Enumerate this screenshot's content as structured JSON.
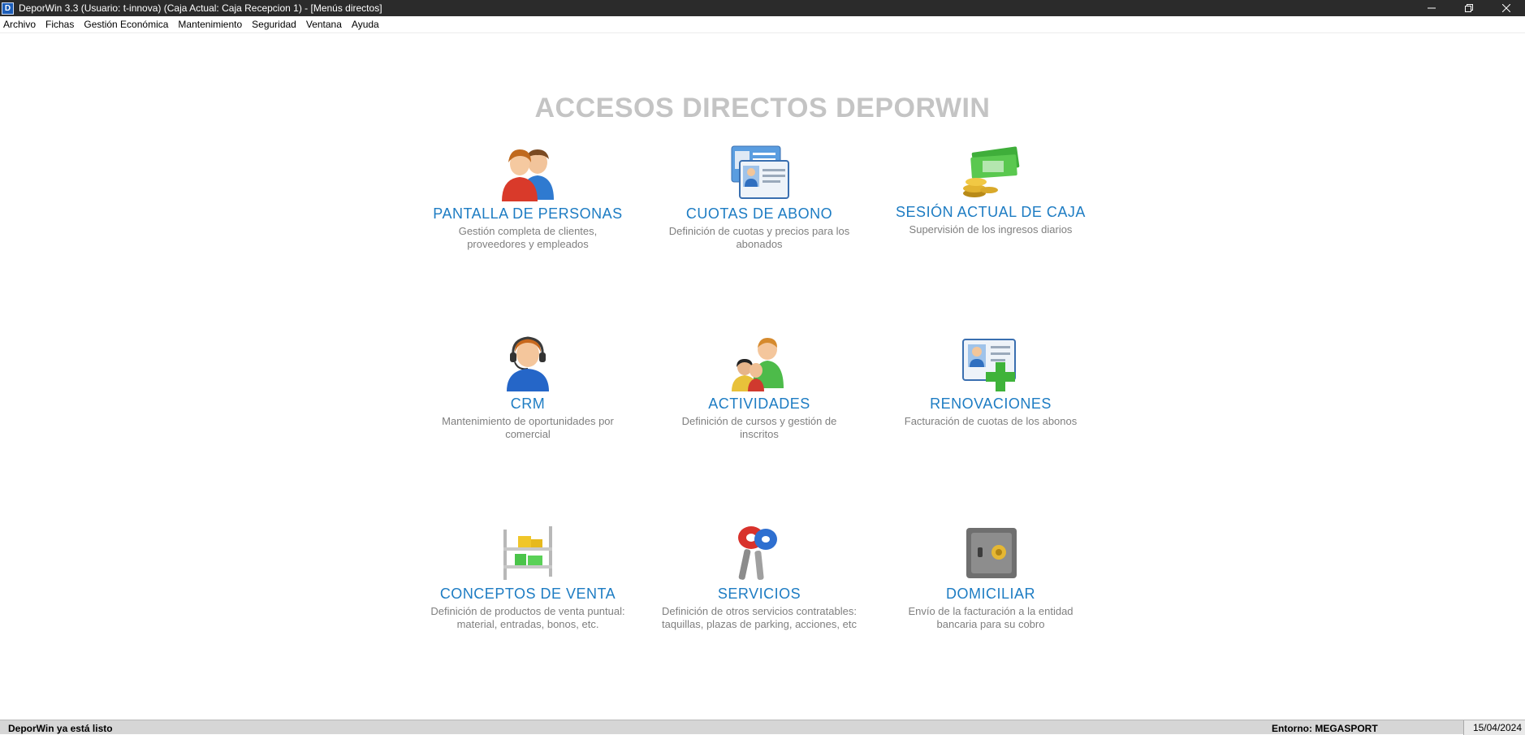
{
  "titlebar": {
    "title": "DeporWin 3.3  (Usuario: t-innova)  (Caja Actual: Caja Recepcion 1) - [Menús directos]",
    "logo_letter": "D"
  },
  "menu": [
    "Archivo",
    "Fichas",
    "Gestión Económica",
    "Mantenimiento",
    "Seguridad",
    "Ventana",
    "Ayuda"
  ],
  "page_title": "ACCESOS DIRECTOS DEPORWIN",
  "tiles": [
    {
      "title": "PANTALLA DE PERSONAS",
      "desc": "Gestión completa de clientes, proveedores y empleados",
      "icon": "people-icon"
    },
    {
      "title": "CUOTAS DE ABONO",
      "desc": "Definición de cuotas y precios para los abonados",
      "icon": "id-cards-icon"
    },
    {
      "title": "SESIÓN ACTUAL DE CAJA",
      "desc": "Supervisión de los ingresos diarios",
      "icon": "money-icon"
    },
    {
      "title": "CRM",
      "desc": "Mantenimiento de oportunidades por comercial",
      "icon": "headset-agent-icon"
    },
    {
      "title": "ACTIVIDADES",
      "desc": "Definición de cursos y gestión de inscritos",
      "icon": "group-icon"
    },
    {
      "title": "RENOVACIONES",
      "desc": "Facturación de cuotas de los abonos",
      "icon": "id-card-add-icon"
    },
    {
      "title": "CONCEPTOS DE VENTA",
      "desc": "Definición de productos de venta puntual: material, entradas, bonos, etc.",
      "icon": "shelf-icon"
    },
    {
      "title": "SERVICIOS",
      "desc": "Definición de otros servicios contratables: taquillas, plazas de parking, acciones, etc",
      "icon": "keys-icon"
    },
    {
      "title": "DOMICILIAR",
      "desc": "Envío de la facturación a la entidad bancaria para su cobro",
      "icon": "safe-icon"
    }
  ],
  "status": {
    "message": "DeporWin ya está listo",
    "environment": "Entorno: MEGASPORT",
    "date": "15/04/2024"
  },
  "colors": {
    "accent": "#1d7cc3",
    "title_gray": "#c4c4c4",
    "desc_gray": "#7f7f7f",
    "titlebar_bg": "#2b2b2b"
  }
}
